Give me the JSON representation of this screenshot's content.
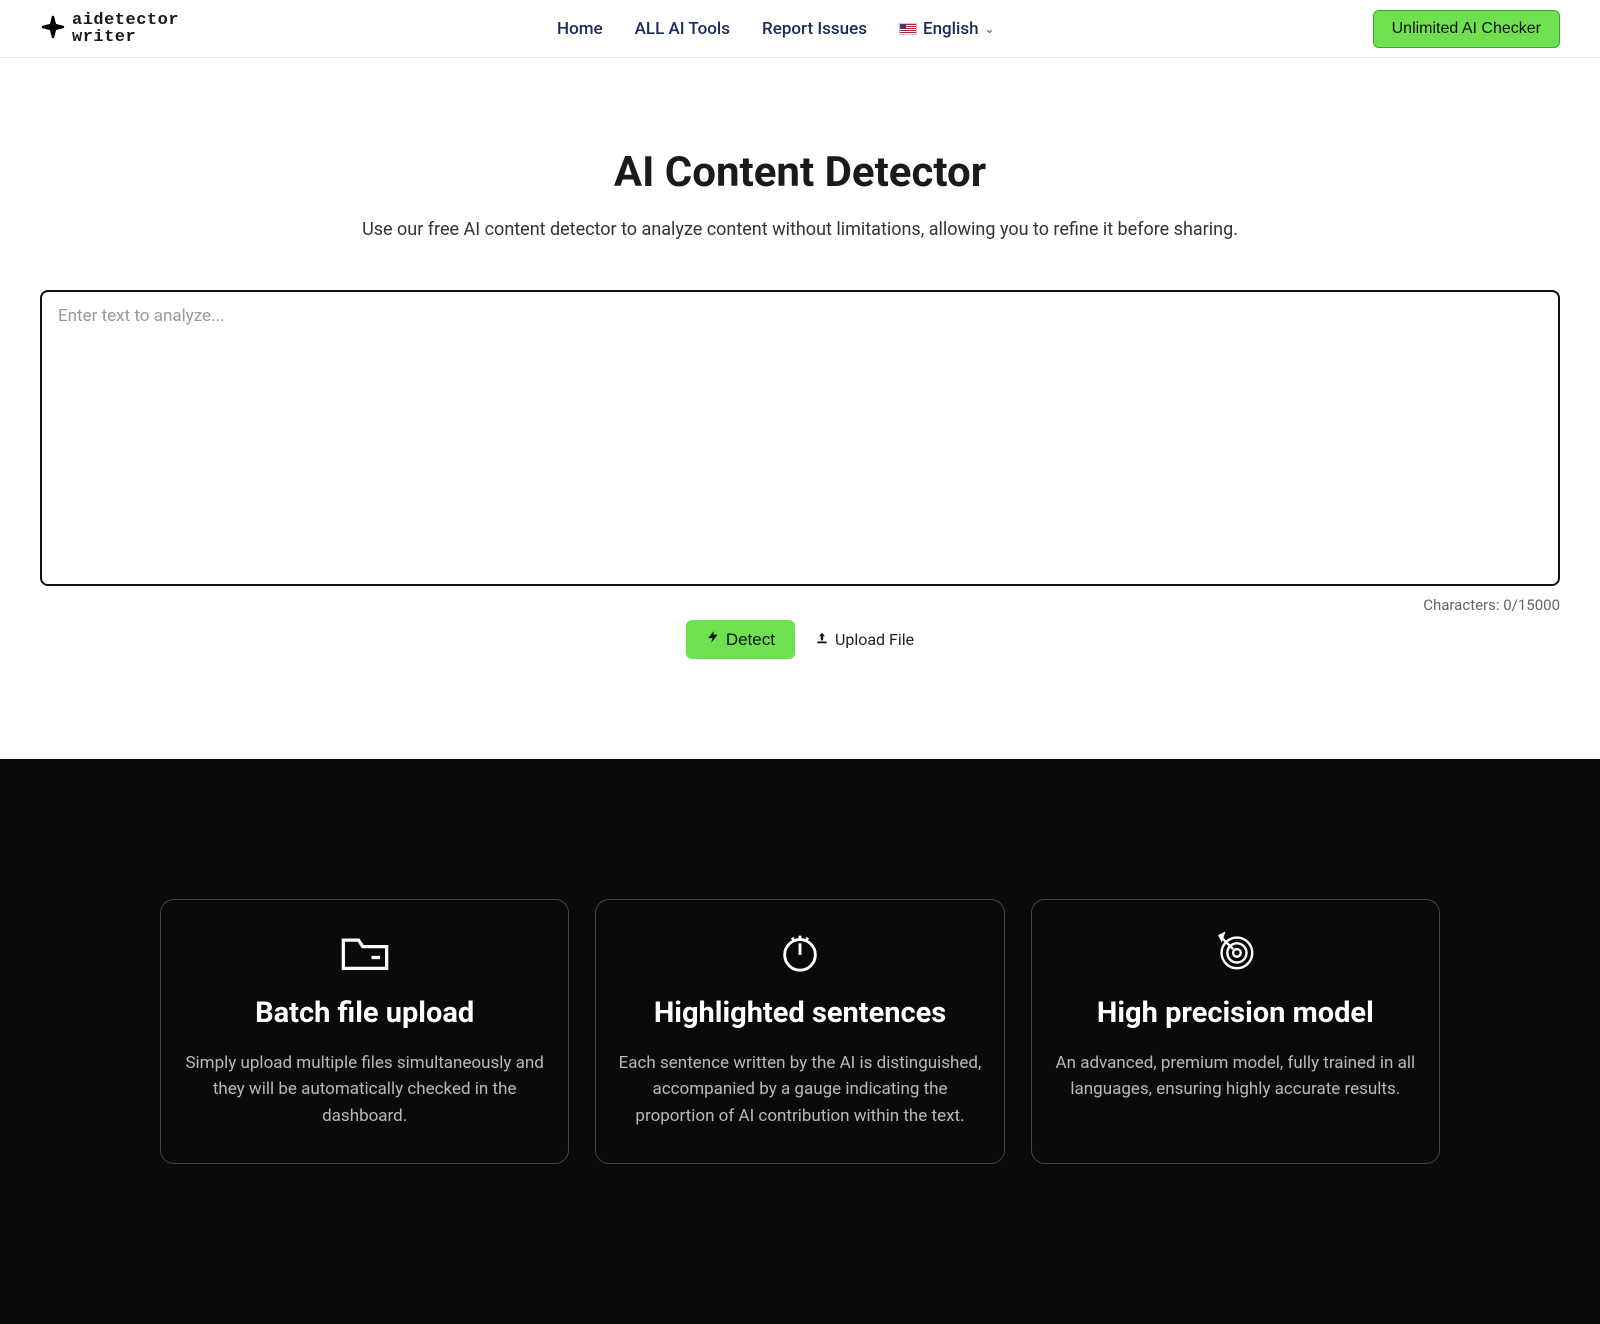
{
  "logo": {
    "line1": "aidetector",
    "line2": "writer"
  },
  "nav": {
    "home": "Home",
    "tools": "ALL AI Tools",
    "report": "Report Issues",
    "lang": "English"
  },
  "cta": "Unlimited AI Checker",
  "hero": {
    "title": "AI Content Detector",
    "subtitle": "Use our free AI content detector to analyze content without limitations, allowing you to refine it before sharing."
  },
  "editor": {
    "placeholder": "Enter text to analyze...",
    "charLabel": "Characters: 0/15000",
    "detect": "Detect",
    "upload": "Upload File"
  },
  "features": [
    {
      "title": "Batch file upload",
      "desc": "Simply upload multiple files simultaneously and they will be automatically checked in the dashboard."
    },
    {
      "title": "Highlighted sentences",
      "desc": "Each sentence written by the AI is distinguished, accompanied by a gauge indicating the proportion of AI contribution within the text."
    },
    {
      "title": "High precision model",
      "desc": "An advanced, premium model, fully trained in all languages, ensuring highly accurate results."
    }
  ]
}
